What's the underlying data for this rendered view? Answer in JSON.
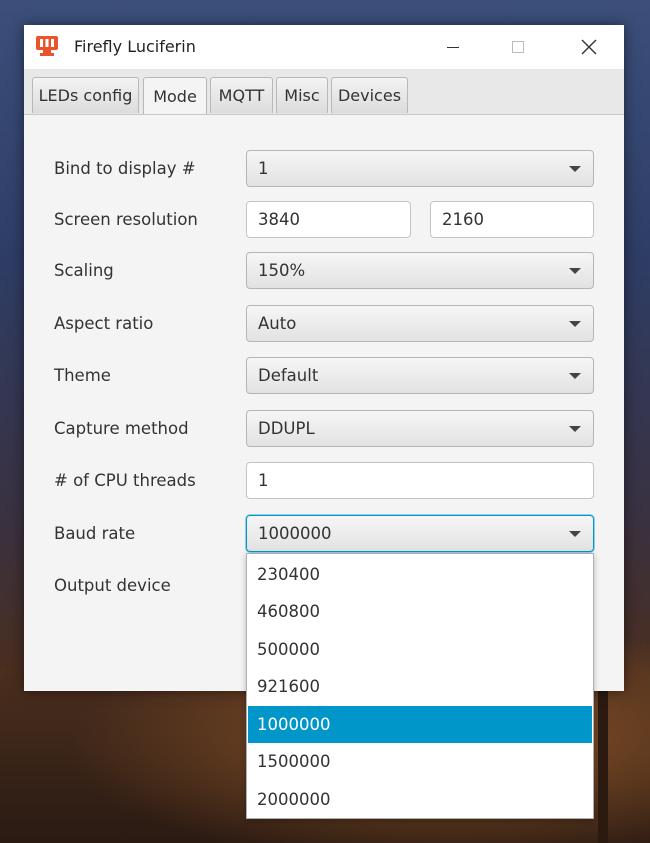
{
  "window": {
    "title": "Firefly Luciferin"
  },
  "tabs": [
    {
      "label": "LEDs config",
      "active": false
    },
    {
      "label": "Mode",
      "active": true
    },
    {
      "label": "MQTT",
      "active": false
    },
    {
      "label": "Misc",
      "active": false
    },
    {
      "label": "Devices",
      "active": false
    }
  ],
  "form": {
    "bind_display": {
      "label": "Bind to display #",
      "value": "1"
    },
    "screen_resolution": {
      "label": "Screen resolution",
      "width": "3840",
      "height": "2160"
    },
    "scaling": {
      "label": "Scaling",
      "value": "150%"
    },
    "aspect_ratio": {
      "label": "Aspect ratio",
      "value": "Auto"
    },
    "theme": {
      "label": "Theme",
      "value": "Default"
    },
    "capture_method": {
      "label": "Capture method",
      "value": "DDUPL"
    },
    "cpu_threads": {
      "label": "# of CPU threads",
      "value": "1"
    },
    "baud_rate": {
      "label": "Baud rate",
      "value": "1000000"
    },
    "output_device": {
      "label": "Output device"
    }
  },
  "baud_dropdown": {
    "options": [
      "230400",
      "460800",
      "500000",
      "921600",
      "1000000",
      "1500000",
      "2000000"
    ],
    "selected": "1000000"
  },
  "colors": {
    "accent": "#0096c9",
    "app_icon": "#e8542b"
  },
  "icons": {
    "app": "firefly-app-icon",
    "minimize": "minimize-icon",
    "maximize": "maximize-icon",
    "close": "close-icon",
    "dropdown": "chevron-down-icon"
  }
}
